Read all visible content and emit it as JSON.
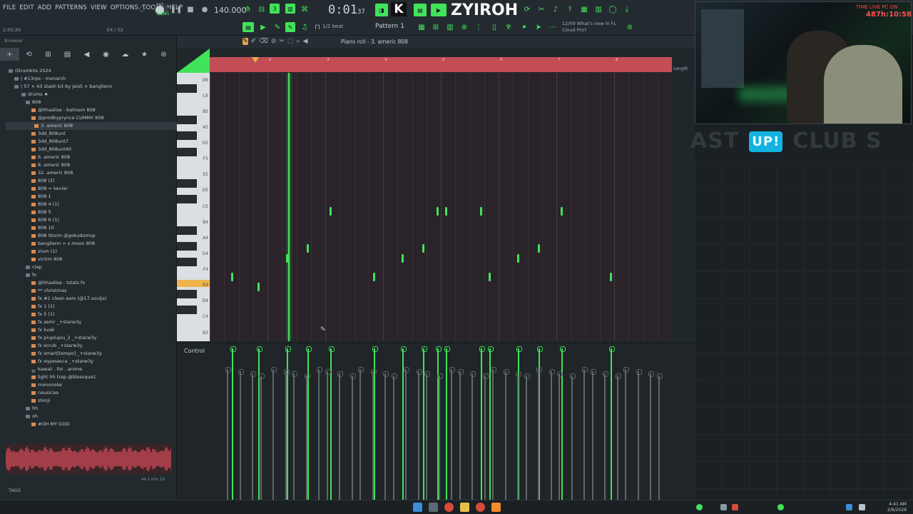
{
  "menu": [
    "FILE",
    "EDIT",
    "ADD",
    "PATTERNS",
    "VIEW",
    "OPTIONS",
    "TOOLS",
    "HELP"
  ],
  "transport": {
    "pat_label": "PAT",
    "song_label": "SONG",
    "tempo": "140.000",
    "time_main": "0:01",
    "time_sub": "37",
    "cursor_pos": "2:05:20",
    "cpu": "E4 / 52"
  },
  "artist": "ZYIROH",
  "logo": "K",
  "snap": "1/2 beat",
  "pattern": "Pattern 1",
  "news": {
    "date": "12/09",
    "line1": "What's new in FL",
    "line2": "Cloud Pro?"
  },
  "browser": {
    "header": "Browser",
    "tabs": [
      "+",
      "⟲",
      "⊞",
      "▤",
      "◀",
      "◉",
      "☁",
      "★",
      "⊛"
    ],
    "items": [
      {
        "label": "(Drumkits 2024",
        "type": "folder"
      },
      {
        "label": "| #13rps - monarch",
        "type": "folder"
      },
      {
        "label": "| 57 × 43 stash kit by jeisli × banglienn",
        "type": "folder"
      },
      {
        "label": "drums ★",
        "type": "folder"
      },
      {
        "label": "808",
        "type": "folder"
      },
      {
        "label": "@hhaalise - balmain 808",
        "type": "file"
      },
      {
        "label": "@prodbyprynce CUMMY 808",
        "type": "file"
      },
      {
        "label": "3. americ 808",
        "type": "file",
        "selected": true
      },
      {
        "label": "3dd_808unt",
        "type": "file"
      },
      {
        "label": "3dd_808unt7",
        "type": "file"
      },
      {
        "label": "3dd_808unt40",
        "type": "file"
      },
      {
        "label": "6. americ 808",
        "type": "file"
      },
      {
        "label": "8. americ 808",
        "type": "file"
      },
      {
        "label": "32. americ 808",
        "type": "file"
      },
      {
        "label": "808 (2)",
        "type": "file"
      },
      {
        "label": "808 = kevlar",
        "type": "file"
      },
      {
        "label": "808 1",
        "type": "file"
      },
      {
        "label": "808 4 (1)",
        "type": "file"
      },
      {
        "label": "808 5",
        "type": "file"
      },
      {
        "label": "808 6 (1)",
        "type": "file"
      },
      {
        "label": "808 10",
        "type": "file"
      },
      {
        "label": "808 Storm @gokudomvp",
        "type": "file"
      },
      {
        "label": "banglienn = s moon 808",
        "type": "file"
      },
      {
        "label": "slum (1)",
        "type": "file"
      },
      {
        "label": "victim 808",
        "type": "file"
      },
      {
        "label": "clap",
        "type": "folder"
      },
      {
        "label": "fx",
        "type": "folder"
      },
      {
        "label": "@hhaalise - tststs fx",
        "type": "file"
      },
      {
        "label": "** christmas",
        "type": "file"
      },
      {
        "label": "fx #1 clean ears (@17.soulja)",
        "type": "file"
      },
      {
        "label": "fx 1 (1)",
        "type": "file"
      },
      {
        "label": "fx 5 (1)",
        "type": "file"
      },
      {
        "label": "fx asmr _+starw3y",
        "type": "file"
      },
      {
        "label": "fx kvak",
        "type": "file"
      },
      {
        "label": "fx piuplupiu_2 _+starw3y",
        "type": "file"
      },
      {
        "label": "fx scrub _+starw3y",
        "type": "file"
      },
      {
        "label": "fx smart[tempo] _+starw3y",
        "type": "file"
      },
      {
        "label": "fx мурмакcа _+starw3y",
        "type": "file"
      },
      {
        "label": "kawaii . for . anime",
        "type": "gear"
      },
      {
        "label": "light hh trap @blessque1",
        "type": "file"
      },
      {
        "label": "mononoke",
        "type": "file"
      },
      {
        "label": "nausicaa",
        "type": "file"
      },
      {
        "label": "shinji",
        "type": "file"
      },
      {
        "label": "hh",
        "type": "folder"
      },
      {
        "label": "oh",
        "type": "folder"
      },
      {
        "label": "#OH MY GOD",
        "type": "file"
      }
    ],
    "wave_info": "44.1 kHz 16",
    "tags": "TAGS"
  },
  "pianoroll": {
    "title": "Piano roll - 3. americ 808",
    "length_label": "Length",
    "control_label": "Control",
    "key_labels": [
      "D6",
      "C6",
      "B5",
      "A5",
      "G5",
      "F5",
      "E5",
      "D5",
      "C5",
      "B4",
      "A4",
      "G4",
      "F4",
      "E4",
      "D4",
      "C4",
      "B3"
    ],
    "bar_numbers": [
      "2",
      "3",
      "4",
      "5",
      "6",
      "7",
      "8"
    ]
  },
  "notes": [
    {
      "beat": 0.3,
      "pitch": "F4"
    },
    {
      "beat": 0.75,
      "pitch": "E4"
    },
    {
      "beat": 1.25,
      "pitch": "G4"
    },
    {
      "beat": 1.6,
      "pitch": "A4"
    },
    {
      "beat": 2.0,
      "pitch": "C5"
    },
    {
      "beat": 2.75,
      "pitch": "F4"
    },
    {
      "beat": 3.25,
      "pitch": "G4"
    },
    {
      "beat": 3.6,
      "pitch": "A4"
    },
    {
      "beat": 3.85,
      "pitch": "C5"
    },
    {
      "beat": 4.0,
      "pitch": "C5"
    },
    {
      "beat": 4.6,
      "pitch": "C5"
    },
    {
      "beat": 4.75,
      "pitch": "F4"
    },
    {
      "beat": 5.25,
      "pitch": "G4"
    },
    {
      "beat": 5.6,
      "pitch": "A4"
    },
    {
      "beat": 6.0,
      "pitch": "C5"
    },
    {
      "beat": 6.85,
      "pitch": "F4"
    }
  ],
  "stream": {
    "banner_left": "AST",
    "banner_up": "UP!",
    "banner_right": "CLUB S",
    "live_text": "TIME LIVE PC ON",
    "live_clock": "487h:10:58"
  },
  "taskbar_clock": {
    "time": "4:41 AM",
    "date": "2/6/2026"
  },
  "colors": {
    "accent": "#41e35a",
    "timeline": "#c24d55",
    "highlight_key": "#f0b24d"
  }
}
